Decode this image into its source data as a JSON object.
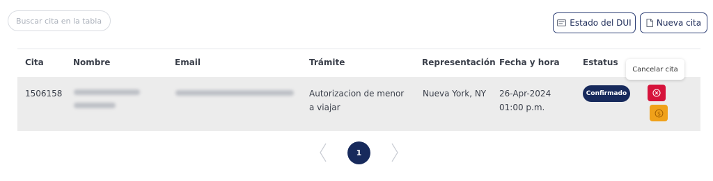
{
  "search": {
    "placeholder": "Buscar cita en la tabla"
  },
  "toolbar": {
    "estado_dui_label": "Estado del DUI",
    "estado_dui_icon": "id-card-icon",
    "nueva_cita_label": "Nueva cita",
    "nueva_cita_icon": "document-icon"
  },
  "table": {
    "headers": [
      "Cita",
      "Nombre",
      "Email",
      "Trámite",
      "Representación",
      "Fecha y hora",
      "Estatus"
    ],
    "rows": [
      {
        "cita": "1506158",
        "nombre": "",
        "email": "",
        "tramite_line1": "Autorizacion de menor",
        "tramite_line2": "a viajar",
        "representacion": "Nueva York, NY",
        "fecha": "26-Apr-2024",
        "hora": "01:00 p.m.",
        "estatus": "Confirmado"
      }
    ]
  },
  "tooltip": {
    "text": "Cancelar cita"
  },
  "actions": {
    "cancel_icon": "cancel-circle-icon",
    "pay_icon": "dollar-coin-icon"
  },
  "pagination": {
    "current_page": "1"
  },
  "colors": {
    "primary": "#172a5c",
    "danger": "#d6133b",
    "warning": "#f0a11a",
    "row_bg": "#ececec"
  }
}
